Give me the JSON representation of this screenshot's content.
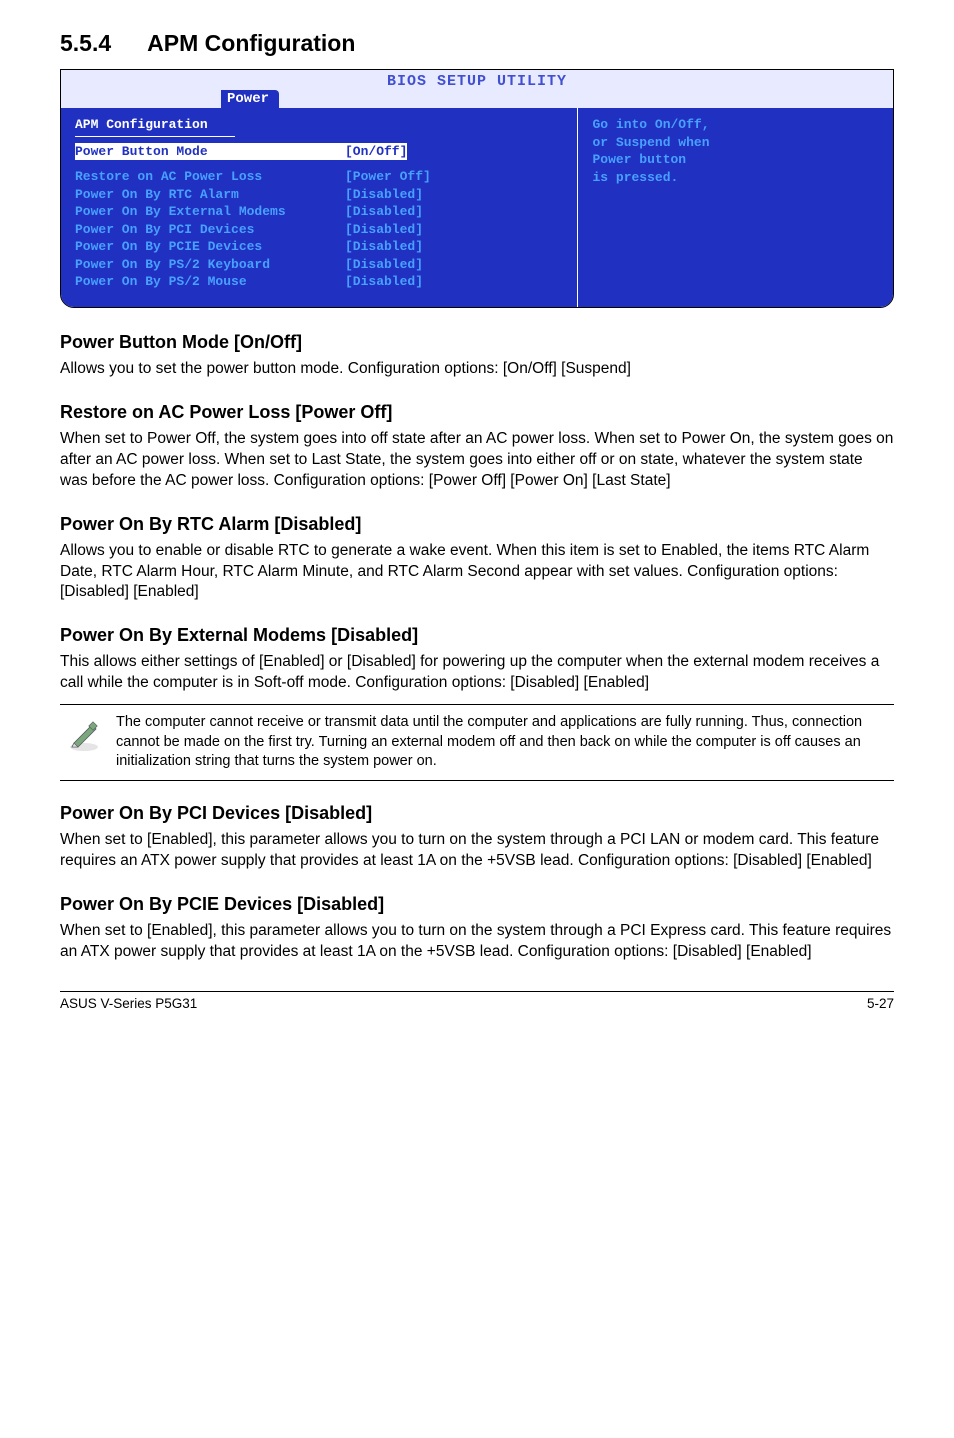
{
  "title_num": "5.5.4",
  "title_text": "APM Configuration",
  "bios": {
    "setup_title": "BIOS SETUP UTILITY",
    "tab": "Power",
    "heading": "APM Configuration",
    "rows": [
      {
        "key": "Power Button Mode",
        "val": "[On/Off]",
        "highlight": true
      },
      {
        "key": "Restore on AC Power Loss",
        "val": "[Power Off]",
        "highlight": false
      },
      {
        "key": "Power On By RTC Alarm",
        "val": "[Disabled]",
        "highlight": false
      },
      {
        "key": "Power On By External Modems",
        "val": "[Disabled]",
        "highlight": false
      },
      {
        "key": "Power On By PCI Devices",
        "val": "[Disabled]",
        "highlight": false
      },
      {
        "key": "Power On By PCIE Devices",
        "val": "[Disabled]",
        "highlight": false
      },
      {
        "key": "Power On By PS/2 Keyboard",
        "val": "[Disabled]",
        "highlight": false
      },
      {
        "key": "Power On By PS/2 Mouse",
        "val": "[Disabled]",
        "highlight": false
      }
    ],
    "help_line1": "Go into On/Off,",
    "help_line2": "or Suspend when",
    "help_line3": "Power button",
    "help_line4": "is pressed."
  },
  "sections": [
    {
      "heading": "Power Button Mode [On/Off]",
      "body": "Allows you to set the power button mode. Configuration options: [On/Off] [Suspend]"
    },
    {
      "heading": "Restore on AC Power Loss [Power Off]",
      "body": "When set to Power Off, the system goes into off state after an AC power loss. When set to Power On, the system goes on after an AC power loss. When set to Last State, the system goes into either off or on state, whatever the system state was before the AC power loss. Configuration options: [Power Off] [Power On] [Last State]"
    },
    {
      "heading": "Power On By RTC Alarm [Disabled]",
      "body": "Allows you to enable or disable RTC to generate a wake event. When this item is set to Enabled, the items RTC Alarm Date, RTC Alarm Hour, RTC Alarm Minute, and RTC Alarm Second appear with set values. Configuration options: [Disabled] [Enabled]"
    },
    {
      "heading": "Power On By External Modems [Disabled]",
      "body": "This allows either settings of [Enabled] or [Disabled] for powering up the computer when the external modem receives a call while the computer is in Soft-off mode. Configuration options: [Disabled] [Enabled]"
    }
  ],
  "note": "The computer cannot receive or transmit data until the computer and applications are fully running. Thus, connection cannot be made on the first try. Turning an external modem off and then back on while the computer is off causes an initialization string that turns the system power on.",
  "sections2": [
    {
      "heading": "Power On By PCI Devices [Disabled]",
      "body": "When set to [Enabled], this parameter allows you to turn on the system through a PCI LAN or modem card. This feature requires an ATX power supply that provides at least 1A on the +5VSB lead. Configuration options: [Disabled] [Enabled]"
    },
    {
      "heading": "Power On By PCIE Devices [Disabled]",
      "body": "When set to [Enabled], this parameter allows you to turn on the system through a PCI Express card. This feature requires an ATX power supply that provides at least 1A on the +5VSB lead.  Configuration options: [Disabled] [Enabled]"
    }
  ],
  "footer_left": "ASUS  V-Series P5G31",
  "footer_right": "5-27"
}
